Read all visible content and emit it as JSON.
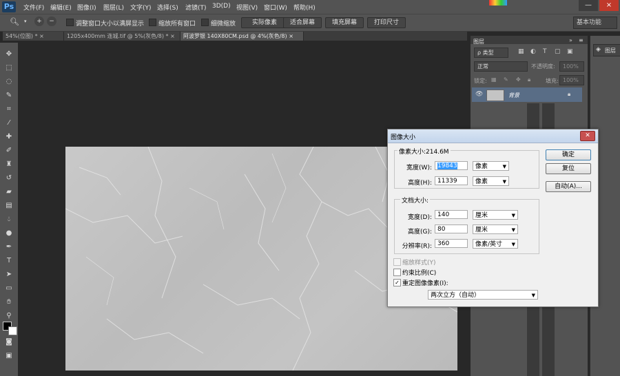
{
  "app": {
    "logo": "Ps"
  },
  "menubar": {
    "items": [
      "文件(F)",
      "编辑(E)",
      "图像(I)",
      "图层(L)",
      "文字(Y)",
      "选择(S)",
      "滤镜(T)",
      "3D(D)",
      "视图(V)",
      "窗口(W)",
      "帮助(H)"
    ],
    "minimize": "—",
    "close": "×"
  },
  "options": {
    "resize_windows": "调整窗口大小以满屏显示",
    "zoom_all": "缩放所有窗口",
    "scrubby_zoom": "细微缩放",
    "actual_pixels": "实际像素",
    "fit_screen": "适合屏幕",
    "fill_screen": "填充屏幕",
    "print_size": "打印尺寸",
    "workspace": "基本功能"
  },
  "tabs": [
    {
      "label": "54%(位图) *",
      "close": "×"
    },
    {
      "label": "1205x400mm 连城.tif @ 5%(灰色/8) *",
      "close": "×"
    },
    {
      "label": "阿波罗银  140X80CM.psd @ 4%(灰色/8)",
      "close": "×"
    }
  ],
  "layers_panel": {
    "tab": "图层",
    "filter": "ρ 类型",
    "blend_mode": "正常",
    "opacity_label": "不透明度:",
    "opacity_value": "100%",
    "lock_label": "锁定:",
    "fill_label": "填充:",
    "fill_value": "100%",
    "layer_name": "背景",
    "right_panel_tab": "图层"
  },
  "dialog": {
    "title": "图像大小",
    "close": "✕",
    "pixel_dimensions_label": "像素大小:214.6M",
    "width_label": "宽度(W):",
    "width_value": "19843",
    "width_unit": "像素",
    "height_label": "高度(H):",
    "height_value": "11339",
    "height_unit": "像素",
    "doc_size_label": "文档大小:",
    "doc_width_label": "宽度(D):",
    "doc_width_value": "140",
    "doc_width_unit": "厘米",
    "doc_height_label": "高度(G):",
    "doc_height_value": "80",
    "doc_height_unit": "厘米",
    "resolution_label": "分辨率(R):",
    "resolution_value": "360",
    "resolution_unit": "像素/英寸",
    "scale_styles": "缩放样式(Y)",
    "constrain": "约束比例(C)",
    "resample": "重定图像像素(I):",
    "resample_method": "两次立方（自动）",
    "ok": "确定",
    "reset": "复位",
    "auto": "自动(A)..."
  }
}
